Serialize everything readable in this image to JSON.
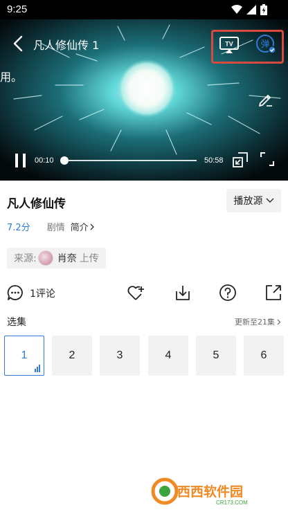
{
  "status_bar": {
    "time": "9:25"
  },
  "player": {
    "title": "凡人修仙传 1",
    "subtitle_fragment": "用。",
    "current_time": "00:10",
    "total_time": "50:58",
    "progress_fraction": 0.003,
    "tv_label": "TV",
    "danmu_label": "弹"
  },
  "info": {
    "title": "凡人修仙传",
    "source_button": "播放源",
    "rating": "7.2分",
    "genre": "剧情",
    "intro_link": "简介",
    "source_label": "来源:",
    "uploader": "肖奈",
    "upload_label": "上传"
  },
  "actions": {
    "comment_count": "1评论"
  },
  "episodes": {
    "label": "选集",
    "update": "更新至21集",
    "items": [
      "1",
      "2",
      "3",
      "4",
      "5",
      "6"
    ],
    "active_index": 0
  },
  "watermark": {
    "text": "西西软件园",
    "sub": "CR173.COM"
  },
  "colors": {
    "accent": "#2f7bd6",
    "highlight": "#d84a3d",
    "chip_bg": "#f2f2f2"
  }
}
